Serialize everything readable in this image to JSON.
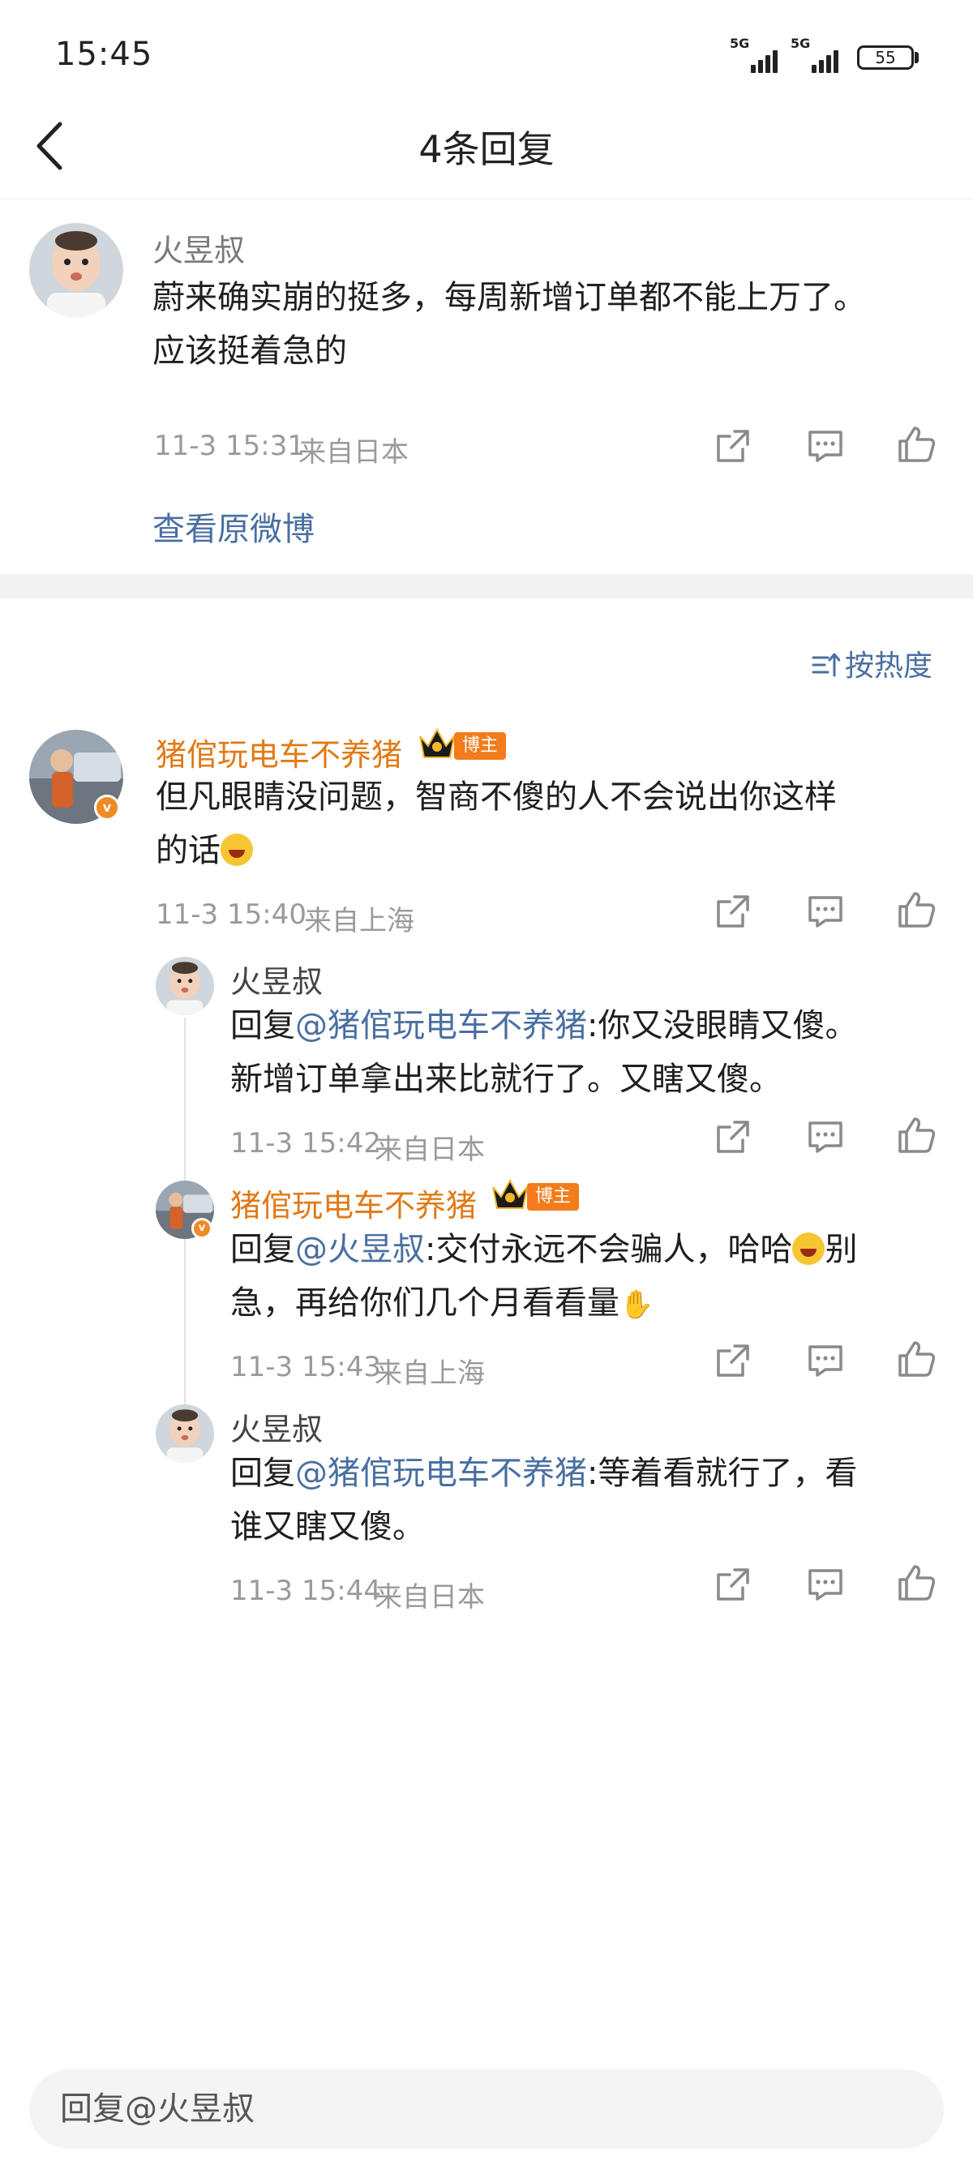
{
  "status_bar": {
    "time": "15:45",
    "signal1": "5G",
    "signal2": "5G",
    "battery": "55"
  },
  "header": {
    "title": "4条回复",
    "back_icon": "chevron-left-icon"
  },
  "original_comment": {
    "user": "火昱叔",
    "text_line1": "蔚来确实崩的挺多，每周新增订单都不能上万了。",
    "text_line2": "应该挺着急的",
    "time": "11-3 15:31",
    "location": "来自日本",
    "view_original": "查看原微博"
  },
  "sort": {
    "label": "按热度",
    "icon": "sort-icon"
  },
  "replies": [
    {
      "user": "猪倌玩电车不养猪",
      "badge": "博主",
      "text_line1": "但凡眼睛没问题，智商不傻的人不会说出你这样",
      "text_line2": "的话",
      "time": "11-3 15:40",
      "location": "来自上海"
    },
    {
      "user": "火昱叔",
      "reply_prefix": "回复",
      "mention": "@猪倌玩电车不养猪",
      "text_line1": ":你又没眼睛又傻。",
      "text_line2": "新增订单拿出来比就行了。又瞎又傻。",
      "time": "11-3 15:42",
      "location": "来自日本"
    },
    {
      "user": "猪倌玩电车不养猪",
      "badge": "博主",
      "reply_prefix": "回复",
      "mention": "@火昱叔",
      "text_line1a": ":交付永远不会骗人，哈哈",
      "text_line1b": "别",
      "text_line2": "急，再给你们几个月看看量",
      "time": "11-3 15:43",
      "location": "来自上海"
    },
    {
      "user": "火昱叔",
      "reply_prefix": "回复",
      "mention": "@猪倌玩电车不养猪",
      "text_line1": ":等着看就行了，看",
      "text_line2": "谁又瞎又傻。",
      "time": "11-3 15:44",
      "location": "来自日本"
    }
  ],
  "reply_input": {
    "placeholder": "回复@火昱叔"
  },
  "colors": {
    "link": "#4a6fa1",
    "orange_name": "#e07a16",
    "badge": "#f37c1c",
    "meta": "#9a9a9a"
  }
}
